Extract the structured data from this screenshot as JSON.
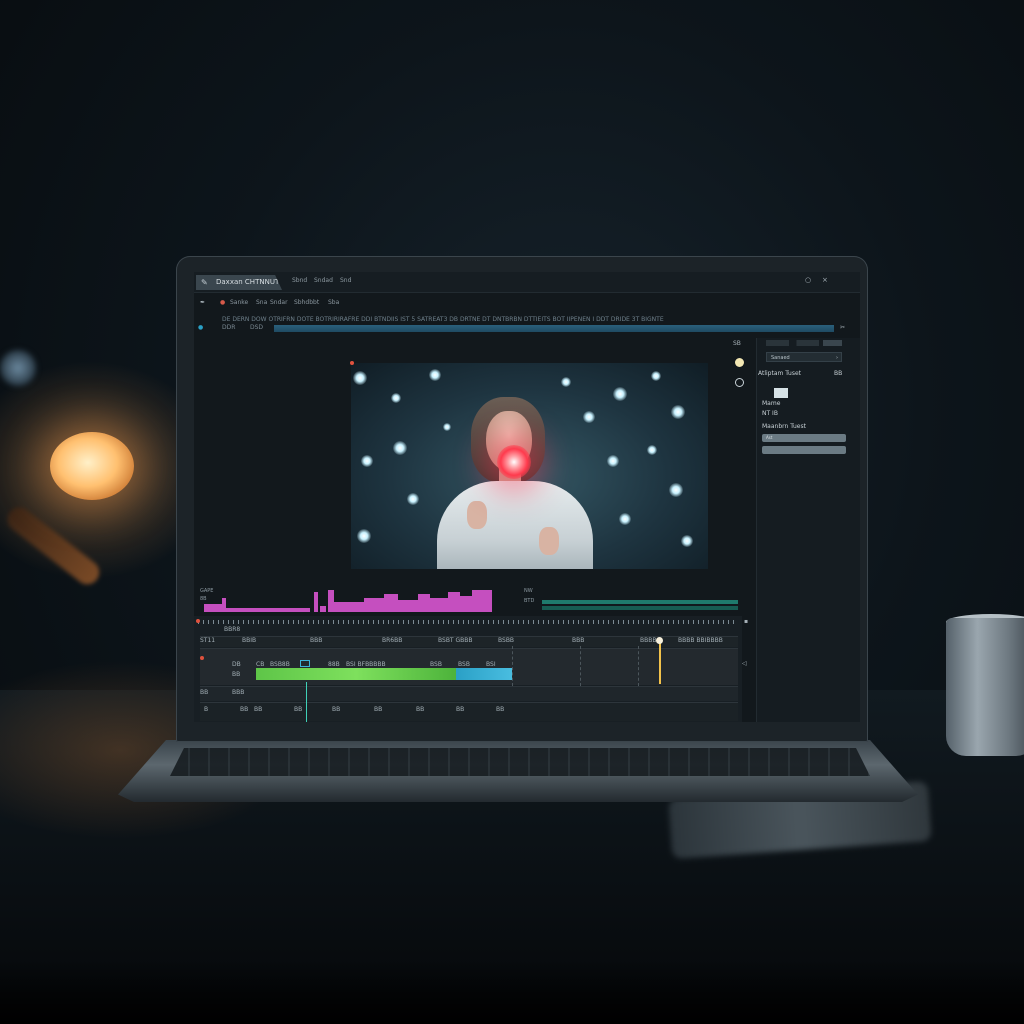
{
  "app": {
    "title": "Daxxan CHTNNUT",
    "menu": [
      "Sbnd",
      "Sndad",
      "Snd"
    ],
    "window_controls": [
      "○",
      "×"
    ]
  },
  "toolbar": {
    "items": [
      "Sanke",
      "Sna",
      "Sndar",
      "Sbhdbbt",
      "Sba"
    ]
  },
  "ruler": {
    "text": "DE DERN DOW OTRIFRN DOTE BOTRIRIRAFRE DDI BTNDIIS IST 5 SATREAT3 DB DRTNE DT DNTBRBN DTTIEITS BOT IIPENEN I DDT DRIDE 3T BIGNTE",
    "left_label": "DDR",
    "left_label2": "DSD"
  },
  "side_panel": {
    "top_label": "SB",
    "dropdown_label": "Sanaed",
    "dropdown_chevron": "›",
    "label_1": "Atliptam Tuset",
    "label_1_value": "BB",
    "label_2": "Mame",
    "label_3": "NT IB",
    "label_4": "Maanbrn Tuest",
    "field_text": "Ast"
  },
  "wave": {
    "left_label_1": "GAPE",
    "left_label_2": "8B",
    "right_label_1": "NW",
    "right_label_2": "BTD"
  },
  "timeline": {
    "header_label": "BBR8",
    "time_labels": [
      "ST11",
      "BBIB",
      "BBB",
      "BR6BB",
      "BSBT GBBB",
      "BSBB",
      "BBB",
      "BBBB",
      "BBBB BBIBBBB"
    ],
    "track_labels": [
      "DB",
      "BB",
      "CB",
      "BSB8B",
      "88B",
      "BSI BFBBBBB",
      "BSB",
      "BSB",
      "BSI"
    ],
    "row3_labels": [
      "BB",
      "BBB"
    ],
    "row4_labels": [
      "B",
      "BB",
      "BB",
      "BB",
      "BB",
      "BB",
      "BB",
      "BB",
      "BB"
    ],
    "right_icons": [
      "▪",
      "◁"
    ]
  },
  "colors": {
    "accent_clip_green": "#6bd151",
    "accent_clip_cyan": "#3bb2d8",
    "waveform": "#c54fbf",
    "playhead": "#f2c24b"
  },
  "icons": {
    "app_icon": "brush-icon",
    "tool_icon": "pen-icon"
  }
}
